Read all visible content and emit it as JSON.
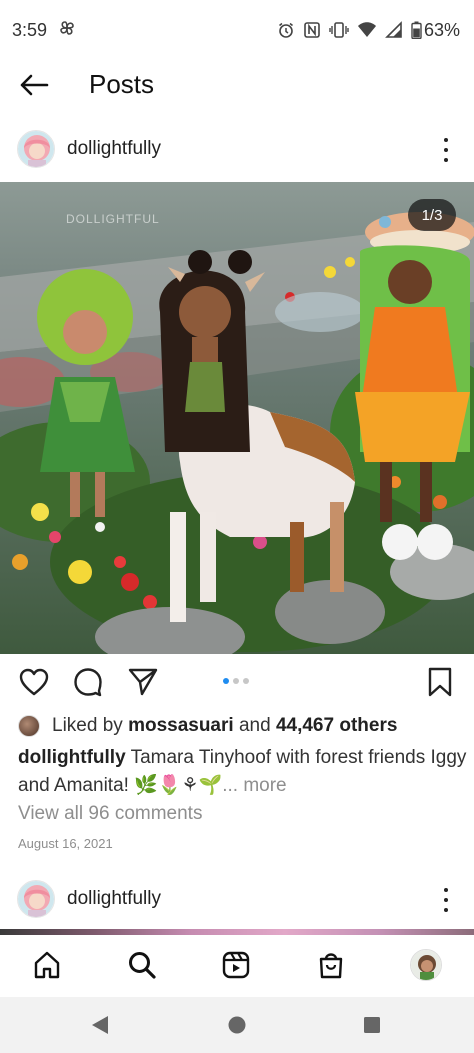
{
  "status_bar": {
    "time": "3:59",
    "battery": "63%"
  },
  "header": {
    "title": "Posts"
  },
  "post": {
    "username": "dollightfully",
    "watermark": "DOLLIGHTFUL",
    "image_counter": "1/3",
    "carousel": {
      "total": 3,
      "active": 1
    },
    "likes": {
      "prefix": "Liked by",
      "liker": "mossasuari",
      "connector": "and",
      "count": "44,467 others"
    },
    "caption": {
      "username": "dollightfully",
      "text": "Tamara Tinyhoof with forest friends Iggy and Amanita! 🌿🌷⚘🌱",
      "more": "... more"
    },
    "comments_link": "View all 96 comments",
    "date": "August 16, 2021"
  },
  "next_post": {
    "username": "dollightfully"
  },
  "bottom_nav": {
    "items": [
      "home-icon",
      "search-icon",
      "reels-icon",
      "shop-icon",
      "profile-avatar"
    ]
  },
  "colors": {
    "accent": "#1f8cf0",
    "muted": "#8e8e8e",
    "text": "#262626"
  }
}
